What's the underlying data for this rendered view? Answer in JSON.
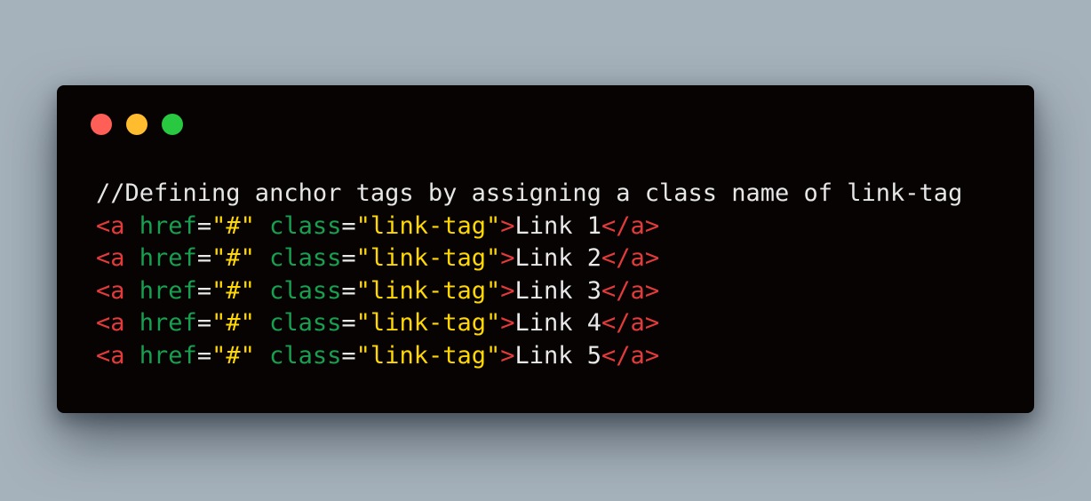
{
  "colors": {
    "background": "#a5b1bb",
    "window": "#070302",
    "dot_close": "#ff5f57",
    "dot_minimize": "#febc2e",
    "dot_maximize": "#28c840",
    "comment": "#e6e6e6",
    "tag": "#e33b3b",
    "attr": "#17a04f",
    "string": "#ffd703",
    "text": "#e8e8e8"
  },
  "window_controls": [
    "close",
    "minimize",
    "maximize"
  ],
  "code": {
    "comment": "//Defining anchor tags by assigning a class name of link-tag",
    "lines": [
      {
        "open": "<a",
        "attr1": "href",
        "eq1": "=",
        "val1": "\"#\"",
        "attr2": "class",
        "eq2": "=",
        "val2": "\"link-tag\"",
        "close_open": ">",
        "text": "Link 1",
        "end_tag": "</a>"
      },
      {
        "open": "<a",
        "attr1": "href",
        "eq1": "=",
        "val1": "\"#\"",
        "attr2": "class",
        "eq2": "=",
        "val2": "\"link-tag\"",
        "close_open": ">",
        "text": "Link 2",
        "end_tag": "</a>"
      },
      {
        "open": "<a",
        "attr1": "href",
        "eq1": "=",
        "val1": "\"#\"",
        "attr2": "class",
        "eq2": "=",
        "val2": "\"link-tag\"",
        "close_open": ">",
        "text": "Link 3",
        "end_tag": "</a>"
      },
      {
        "open": "<a",
        "attr1": "href",
        "eq1": "=",
        "val1": "\"#\"",
        "attr2": "class",
        "eq2": "=",
        "val2": "\"link-tag\"",
        "close_open": ">",
        "text": "Link 4",
        "end_tag": "</a>"
      },
      {
        "open": "<a",
        "attr1": "href",
        "eq1": "=",
        "val1": "\"#\"",
        "attr2": "class",
        "eq2": "=",
        "val2": "\"link-tag\"",
        "close_open": ">",
        "text": "Link 5",
        "end_tag": "</a>"
      }
    ]
  }
}
